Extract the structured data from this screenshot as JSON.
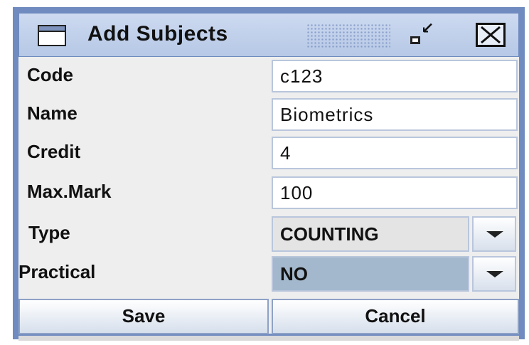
{
  "window": {
    "title": "Add Subjects"
  },
  "form": {
    "code_label": "Code",
    "code_value": "c123",
    "name_label": "Name",
    "name_value": "Biometrics",
    "credit_label": "Credit",
    "credit_value": "4",
    "maxmark_label": "Max.Mark",
    "maxmark_value": "100",
    "type_label": "Type",
    "type_value": "COUNTING",
    "practical_label": "Practical",
    "practical_value": "NO"
  },
  "buttons": {
    "save_label": "Save",
    "cancel_label": "Cancel"
  },
  "icons": {
    "window": "window-icon",
    "iconify": "iconify-icon",
    "close": "close-icon",
    "dropdown": "chevron-down-icon"
  },
  "colors": {
    "frame": "#6f8bbf",
    "titlebar": "#c4d3ec",
    "selected_combo": "#a3b8cc"
  }
}
